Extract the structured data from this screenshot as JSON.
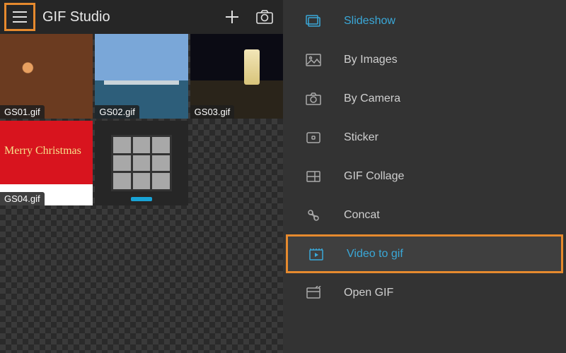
{
  "header": {
    "title": "GIF Studio"
  },
  "gallery": {
    "items": [
      {
        "filename": "GS01.gif",
        "xmas": ""
      },
      {
        "filename": "GS02.gif",
        "xmas": ""
      },
      {
        "filename": "GS03.gif",
        "xmas": ""
      },
      {
        "filename": "GS04.gif",
        "xmas": "Merry Christmas"
      },
      {
        "filename": "",
        "xmas": ""
      }
    ]
  },
  "menu": {
    "items": [
      {
        "label": "Slideshow"
      },
      {
        "label": "By Images"
      },
      {
        "label": "By Camera"
      },
      {
        "label": "Sticker"
      },
      {
        "label": "GIF Collage"
      },
      {
        "label": "Concat"
      },
      {
        "label": "Video to gif"
      },
      {
        "label": "Open GIF"
      }
    ]
  }
}
